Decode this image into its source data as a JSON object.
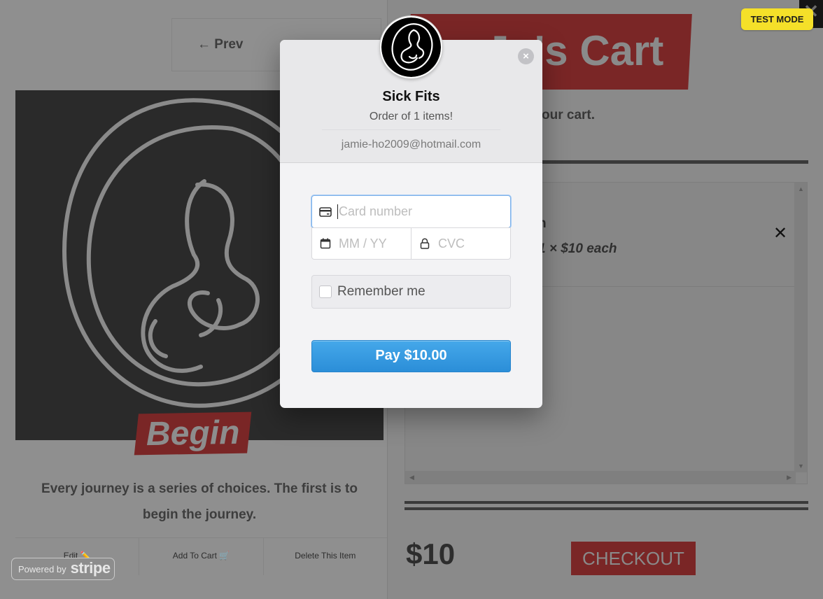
{
  "background": {
    "pagination": {
      "prev_label": "← Prev"
    },
    "product": {
      "title": "Begin",
      "description": "Every journey is a series of choices. The first is to begin the journey.",
      "buttons": {
        "edit": "Edit ✏️",
        "add_to_cart": "Add To Cart 🛒",
        "delete": "Delete This Item"
      }
    },
    "cart": {
      "close_label": "✕",
      "title": "Jo's Cart",
      "subtitle": "our cart.",
      "item": {
        "name": "n",
        "quantity_text": "1 × $10 each",
        "remove_label": "✕"
      },
      "total": "$10",
      "checkout_label": "CHECKOUT"
    }
  },
  "test_mode_badge": "TEST MODE",
  "powered_by": {
    "prefix": "Powered by",
    "brand": "stripe"
  },
  "checkout_modal": {
    "store_name": "Sick Fits",
    "description": "Order of 1 items!",
    "email": "jamie-ho2009@hotmail.com",
    "close_label": "×",
    "card_number_placeholder": "Card number",
    "expiry_placeholder": "MM / YY",
    "cvc_placeholder": "CVC",
    "remember_me_label": "Remember me",
    "pay_button_label": "Pay $10.00"
  },
  "colors": {
    "pay_button": "#2b8ed8",
    "test_mode": "#f5e029",
    "accent_red": "#7a2626"
  },
  "icons": [
    "card-icon",
    "calendar-icon",
    "lock-icon",
    "close-icon",
    "fetus-logo-icon",
    "pencil-icon",
    "cart-icon"
  ]
}
